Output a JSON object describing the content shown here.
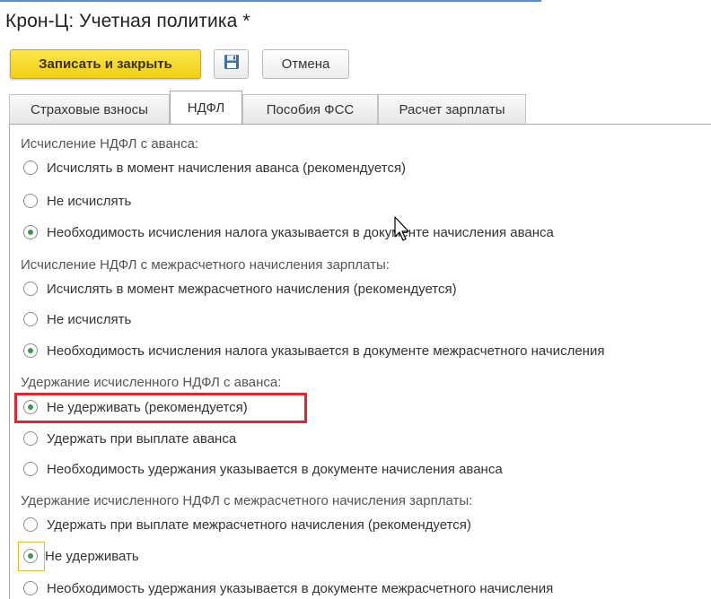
{
  "window": {
    "title": "Крон-Ц: Учетная политика *"
  },
  "toolbar": {
    "save_close_label": "Записать и закрыть",
    "save_icon": "floppy-disk-icon",
    "cancel_label": "Отмена"
  },
  "tabs": [
    {
      "label": "Страховые взносы",
      "active": false
    },
    {
      "label": "НДФЛ",
      "active": true
    },
    {
      "label": "Пособия ФСС",
      "active": false
    },
    {
      "label": "Расчет зарплаты",
      "active": false
    }
  ],
  "groups": [
    {
      "label": "Исчисление НДФЛ с аванса:",
      "options": [
        {
          "label": "Исчислять в момент начисления аванса (рекомендуется)",
          "selected": false
        },
        {
          "label": "Не исчислять",
          "selected": false
        },
        {
          "label": "Необходимость исчисления налога указывается в документе начисления аванса",
          "selected": true
        }
      ]
    },
    {
      "label": "Исчисление НДФЛ с межрасчетного начисления зарплаты:",
      "options": [
        {
          "label": "Исчислять в момент межрасчетного начисления (рекомендуется)",
          "selected": false
        },
        {
          "label": "Не исчислять",
          "selected": false
        },
        {
          "label": "Необходимость исчисления налога указывается в документе межрасчетного начисления",
          "selected": true
        }
      ]
    },
    {
      "label": "Удержание исчисленного НДФЛ с аванса:",
      "options": [
        {
          "label": "Не удерживать (рекомендуется)",
          "selected": true
        },
        {
          "label": "Удержать при выплате аванса",
          "selected": false
        },
        {
          "label": "Необходимость удержания указывается в документе начисления аванса",
          "selected": false
        }
      ]
    },
    {
      "label": "Удержание исчисленного НДФЛ с межрасчетного начисления зарплаты:",
      "options": [
        {
          "label": "Удержать при выплате межрасчетного начисления (рекомендуется)",
          "selected": false
        },
        {
          "label": "Не удерживать",
          "selected": true
        },
        {
          "label": "Необходимость удержания указывается в документе межрасчетного начисления",
          "selected": false
        }
      ]
    }
  ],
  "colors": {
    "accent_yellow": "#f2cf14",
    "radio_selected": "#3a9a4a",
    "highlight_red": "#e0262e",
    "focus_yellow": "#e8b923"
  }
}
